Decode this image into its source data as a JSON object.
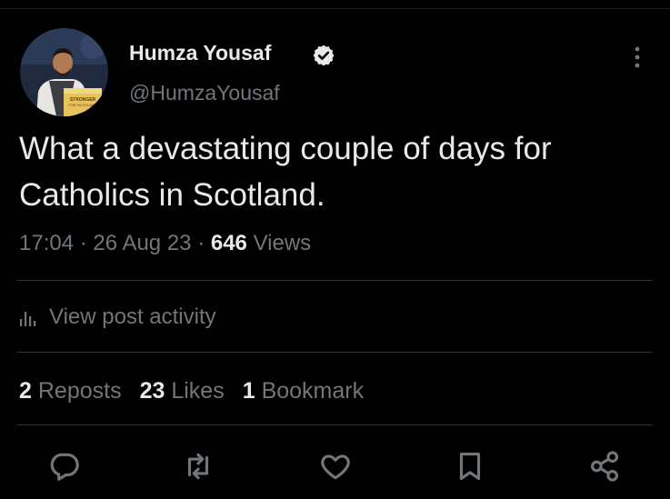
{
  "author": {
    "display_name": "Humza Yousaf",
    "handle": "@HumzaYousaf",
    "verified": true,
    "avatar_podium_text": "STRONGER FOR SCOTLAND"
  },
  "tweet": {
    "text_line_1": "What a devastating couple of days for",
    "text_line_2": "Catholics in Scotland."
  },
  "meta": {
    "time": "17:04",
    "separator": "·",
    "date": "26 Aug 23",
    "views_count": "646",
    "views_label": "Views"
  },
  "activity": {
    "label": "View post activity"
  },
  "stats": {
    "reposts_count": "2",
    "reposts_label": "Reposts",
    "likes_count": "23",
    "likes_label": "Likes",
    "bookmarks_count": "1",
    "bookmarks_label": "Bookmark"
  },
  "actions": [
    "reply-icon",
    "repost-icon",
    "like-icon",
    "bookmark-icon",
    "share-icon"
  ],
  "colors": {
    "background": "#000000",
    "primary_text": "#e7e9ea",
    "secondary_text": "#71767b",
    "divider": "#2f3336"
  }
}
